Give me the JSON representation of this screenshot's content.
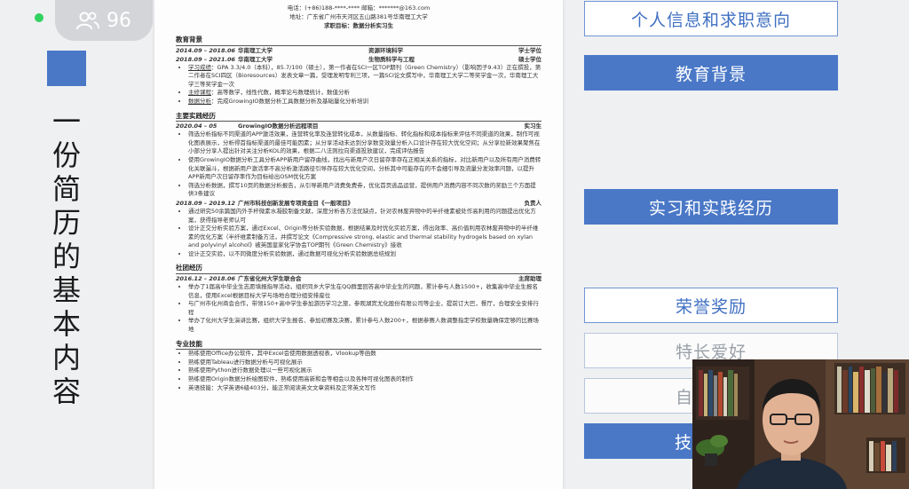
{
  "meeting": {
    "participant_count": "96"
  },
  "slide": {
    "vertical_title": [
      "一",
      "份",
      "简",
      "历",
      "的",
      "基",
      "本",
      "内",
      "容"
    ],
    "nav": [
      {
        "label": "个人信息和求职意向"
      },
      {
        "label": "教育背景"
      },
      {
        "label": "实习和实践经历"
      },
      {
        "label": "荣誉奖励"
      },
      {
        "label": "特长爱好"
      },
      {
        "label": "自"
      },
      {
        "label": "技"
      }
    ]
  },
  "resume": {
    "header": {
      "contact": "电话：(+86)188-****-****    邮箱：*******@163.com",
      "address": "地址：广东省广州市天河区五山路381号华南理工大学",
      "objective": "求职目标：数据分析实习生"
    },
    "education": {
      "title": "教育背景",
      "rows": [
        {
          "date": "2014.09 – 2018.06",
          "org": "华南理工大学",
          "major": "资源环境科学",
          "degree": "学士学位"
        },
        {
          "date": "2018.09 – 2021.06",
          "org": "华南理工大学",
          "major": "生物质科学与工程",
          "degree": "硕士学位"
        }
      ],
      "bullets": [
        {
          "label": "学习成绩",
          "text": "GPA 3.3/4.0（本科），85.7/100（硕士），第一作者在SCI一区TOP期刊（Green Chemistry）（影响因子9.43）正在撰投，第二作者在SCI四区（Bioresources）发表文章一篇，受理发明专利三项，一篇SCI论文撰写中，华南理工大学二等奖学金一次，华南理工大学三等奖学金一次"
        },
        {
          "label": "主修课程",
          "text": "高等数学，线性代数，概率论与数理统计，数值分析"
        },
        {
          "label": "数据分析",
          "text": "完成GrowingIO数据分析工具数据分析及基础量化分析培训"
        }
      ]
    },
    "experience": {
      "title": "主要实践经历",
      "jobs": [
        {
          "date": "2020.04 – 05",
          "org": "GrowingIO数据分析远程项目",
          "role": "实习生",
          "bullets": [
            "筛选分析指标不同渠道的APP激活效果，连营转化率及连营转化成本，从数量指标、转化指标和成本指标来评估不同渠道的效果，制作可视化图表展示，分析得首指标渠道的最佳可能因素；从分享活动未达到分享数变效量分析入口设计存在较大优化空间；从分享拉新效果聚焦在小部分分享人提出针对关注分析KOL的效果，根据二八法则拉向渠道投放建议，完成评估报告",
            "使用GrowingIO数据分析工具分析APP新用户留存曲线，找出与新用户次日留存率存在正相关关系的指标，对比新用户以及所有用户消费转化关联漏斗，根据新用户激活率不高分析激活路径引导存在较大优化空间，分析其中可能存在的不会细引导及流量分发效率问题，以提升APP新用户次日留存率作为目标给出OSM优化方案",
            "筛选分析数据，撰写10页的数据分析报告，从引导新用户消费免费券，优化首页逃品运营，提供用户消费内容不同次数的奖励三个方面提供3条建议"
          ]
        },
        {
          "date": "2018.09 – 2019.12",
          "org": "广州市科技创新发展专项资金目《一般项目》",
          "role": "负责人",
          "bullets": [
            "通过研究50余篇国内外手杆微素水凝胶制备文献，深度分析各方法优缺点，针对农林废弃物中的半纤维素被处作高利用的问题提出优化方案，获得指导老师认可",
            "设计正交分析实验方案，通过Excel、Origin等分析实验数据，根据结果及时优化实验方案，得出效率、高价值利用农林废弃物中的半纤维素的优化方案（半纤维素制备方法，并撰写论文《Compressive strong, elastic and thermal stability hydrogels based on xylan and polyvinyl alcohol》被英国皇家化学协会TOP期刊《Green Chemistry》接收",
            "设计正交实验，以不同微度分析实验数据，通过数据可视化分析实验数据总结规划"
          ]
        }
      ]
    },
    "club": {
      "title": "社团经历",
      "date": "2016.12 – 2018.06",
      "org": "广东省化州大学生联合会",
      "role": "主席助理",
      "bullets": [
        "举办了1届高中毕业生志愿填报指导活动，组织同乡大学生在QQ群里回答高中毕业生的问题，累计参与人数1500+，收集高中毕业生报名信息，使用Excel根据目标大学与场地合理分组安排座位",
        "与广州市化州商会合作，带领150+高中学生参加游历学习之旅，参观湖宾尤化股份有限公司等企业，提前订大巴，餐厅，合理安全安排行程",
        "举办了化州大学生演讲比赛，组织大学生报名、参加初赛及决赛，累计参与人数200+，根据参赛人数调整指定学校数量确保定够的比赛场地"
      ]
    },
    "skills": {
      "title": "专业技能",
      "bullets": [
        "熟练使用Office办公软件，其中Excel会使用数据透视表，Vlookup等函数",
        "熟练使用Tableau进行数据分析与可视化展示",
        "熟练使用Python进行数据处理以一些可视化展示",
        "熟练使用Origin数据分析绘图软件，熟练使用高新和会等相会以及各种可视化图表的制作",
        "英语技能：大学英语6级403分，能正常阅读英文文章资料及正常英文写作"
      ]
    }
  },
  "colors": {
    "accent": "#4a78c7",
    "live": "#32d260"
  }
}
